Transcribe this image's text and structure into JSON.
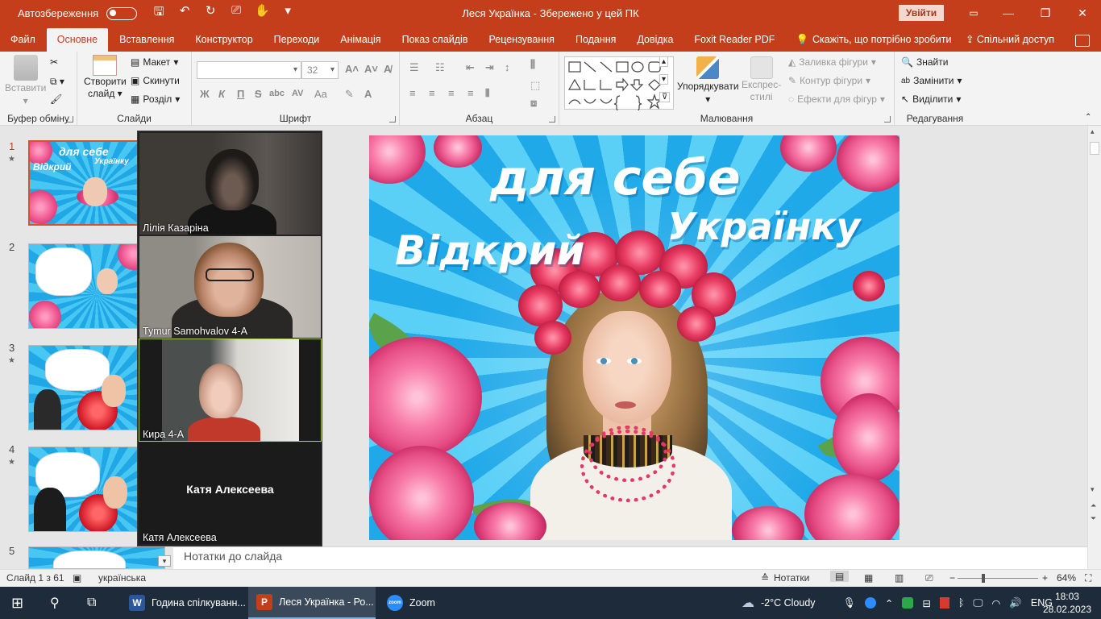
{
  "titlebar": {
    "autosave_label": "Автозбереження",
    "doc_title": "Леся Українка  -  Збережено у цей ПК",
    "signin_label": "Увійти"
  },
  "tabs": [
    {
      "label": "Файл"
    },
    {
      "label": "Основне"
    },
    {
      "label": "Вставлення"
    },
    {
      "label": "Конструктор"
    },
    {
      "label": "Переходи"
    },
    {
      "label": "Анімація"
    },
    {
      "label": "Показ слайдів"
    },
    {
      "label": "Рецензування"
    },
    {
      "label": "Подання"
    },
    {
      "label": "Довідка"
    },
    {
      "label": "Foxit Reader PDF"
    }
  ],
  "tellme_label": "Скажіть, що потрібно зробити",
  "share_label": "Спільний доступ",
  "ribbon": {
    "clipboard": {
      "label": "Буфер обміну",
      "paste": "Вставити"
    },
    "slides": {
      "label": "Слайди",
      "new_slide_1": "Створити",
      "new_slide_2": "слайд",
      "layout": "Макет",
      "reset": "Скинути",
      "section": "Розділ"
    },
    "font": {
      "label": "Шрифт",
      "font_name": "",
      "font_size": "32",
      "bold": "Ж",
      "italic": "К",
      "underline": "П",
      "strike": "S",
      "shadow": "abc",
      "spacing": "AV",
      "case": "Aa"
    },
    "paragraph": {
      "label": "Абзац"
    },
    "drawing": {
      "label": "Малювання",
      "arrange_1": "Упорядкувати",
      "styles_1": "Експрес-",
      "styles_2": "стилі",
      "fill": "Заливка фігури",
      "outline": "Контур фігури",
      "effects": "Ефекти для фігур"
    },
    "editing": {
      "label": "Редагування",
      "find": "Знайти",
      "replace": "Замінити",
      "select": "Виділити"
    }
  },
  "thumbnails": [
    {
      "num": "1"
    },
    {
      "num": "2"
    },
    {
      "num": "3"
    },
    {
      "num": "4"
    },
    {
      "num": "5"
    }
  ],
  "thumb1": {
    "line1": "для себе",
    "line2": "Українку",
    "line3": "Відкрий"
  },
  "zoom": {
    "tiles": [
      {
        "name": "Лілія Казаріна"
      },
      {
        "name": "Tymur Samohvalov 4-A"
      },
      {
        "name": "Кира 4-А"
      },
      {
        "name": "Катя Алексеева",
        "center": "Катя Алексеева"
      }
    ]
  },
  "slide": {
    "line1": "для себе",
    "line2": "Українку",
    "line3": "Відкрий"
  },
  "notes_placeholder": "Нотатки до слайда",
  "status": {
    "slide_of": "Слайд 1 з 61",
    "language": "українська",
    "notes_label": "Нотатки",
    "zoom_level": "64%"
  },
  "taskbar": {
    "items": [
      {
        "label": "Година спілкуванн...",
        "badge": "W",
        "color": "#2b579a"
      },
      {
        "label": "Леся Українка - Ро...",
        "badge": "P",
        "color": "#c43e1c"
      },
      {
        "label": "Zoom",
        "badge": "zoom",
        "color": "#2d8cff"
      }
    ],
    "weather": "-2°C  Cloudy",
    "lang": "ENG",
    "time": "18:03",
    "date": "28.02.2023"
  }
}
